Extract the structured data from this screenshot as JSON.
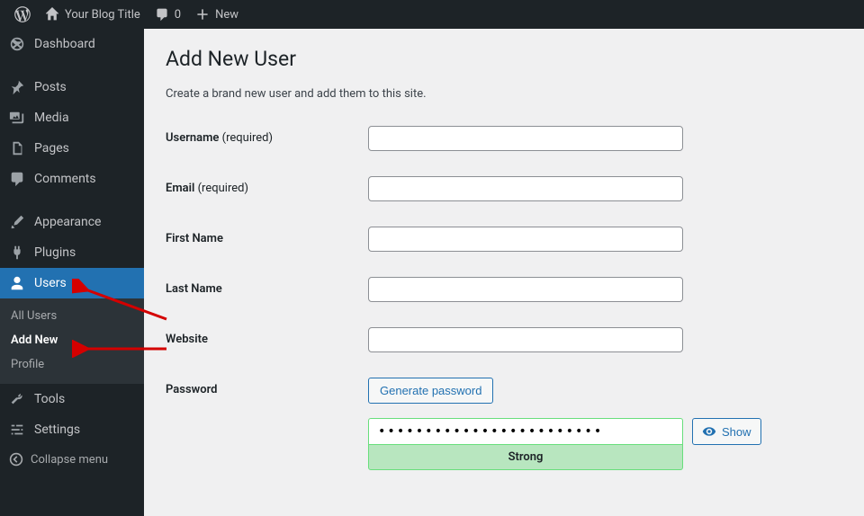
{
  "toolbar": {
    "site_name": "Your Blog Title",
    "comments_count": "0",
    "new_label": "New"
  },
  "sidebar": {
    "dashboard": "Dashboard",
    "posts": "Posts",
    "media": "Media",
    "pages": "Pages",
    "comments": "Comments",
    "appearance": "Appearance",
    "plugins": "Plugins",
    "users": "Users",
    "users_sub": {
      "all": "All Users",
      "add": "Add New",
      "profile": "Profile"
    },
    "tools": "Tools",
    "settings": "Settings",
    "collapse": "Collapse menu"
  },
  "page": {
    "title": "Add New User",
    "intro": "Create a brand new user and add them to this site.",
    "labels": {
      "username": "Username",
      "email": "Email",
      "first_name": "First Name",
      "last_name": "Last Name",
      "website": "Website",
      "password": "Password",
      "required": " (required)"
    },
    "generate_btn": "Generate password",
    "password_value": "••••••••••••••••••••••••",
    "strength": "Strong",
    "show_btn": "Show"
  }
}
